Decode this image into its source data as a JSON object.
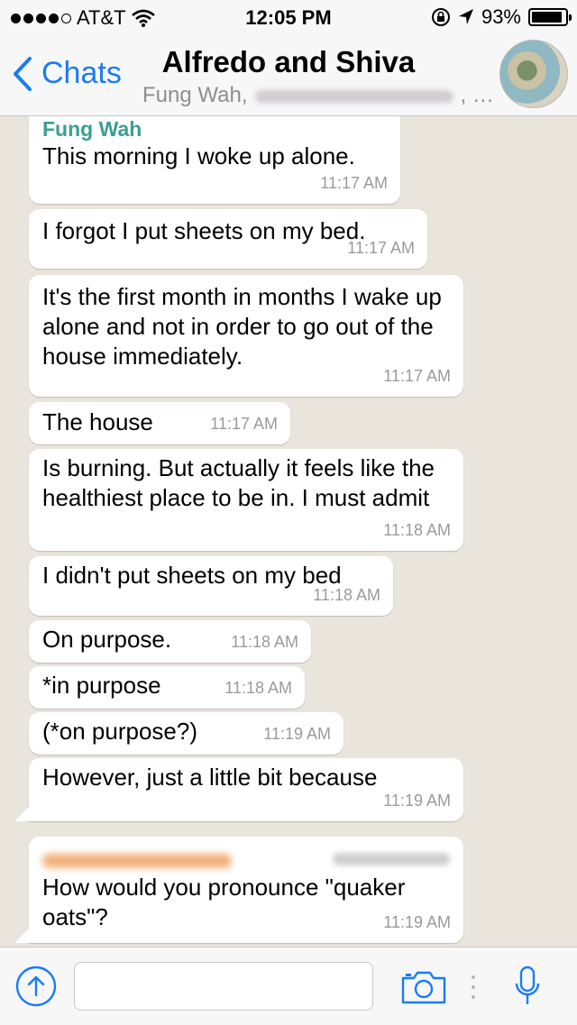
{
  "status_bar": {
    "carrier": "AT&T",
    "time": "12:05 PM",
    "battery_percent": "93%",
    "battery_level": 0.93
  },
  "nav": {
    "back_label": "Chats",
    "title": "Alfredo and Shiva",
    "subtitle_prefix": "Fung Wah,",
    "subtitle_suffix": ", …"
  },
  "messages": [
    {
      "sender": "Fung Wah",
      "text": "This morning I woke up alone.",
      "time": "11:17 AM"
    },
    {
      "text": "I forgot I put sheets on my bed.",
      "time": "11:17 AM"
    },
    {
      "text": "It's the first month in months I wake up alone and not in order to go out of the house immediately.",
      "time": "11:17 AM"
    },
    {
      "text": "The house",
      "time": "11:17 AM"
    },
    {
      "text": "Is burning. But actually it feels like the healthiest place to be in. I must admit",
      "time": "11:18 AM"
    },
    {
      "text": "I didn't put sheets on my bed",
      "time": "11:18 AM"
    },
    {
      "text": "On purpose.",
      "time": "11:18 AM"
    },
    {
      "text": "*in purpose",
      "time": "11:18 AM"
    },
    {
      "text": "(*on purpose?)",
      "time": "11:19 AM"
    },
    {
      "text": "However, just a little bit because",
      "time": "11:19 AM"
    },
    {
      "text": "How would you pronounce \"quaker oats\"?",
      "time": "11:19 AM"
    }
  ],
  "input": {
    "placeholder": ""
  },
  "colors": {
    "accent": "#1a7cf5",
    "sender_name": "#3aa091",
    "chat_background": "#e9e4dc"
  }
}
